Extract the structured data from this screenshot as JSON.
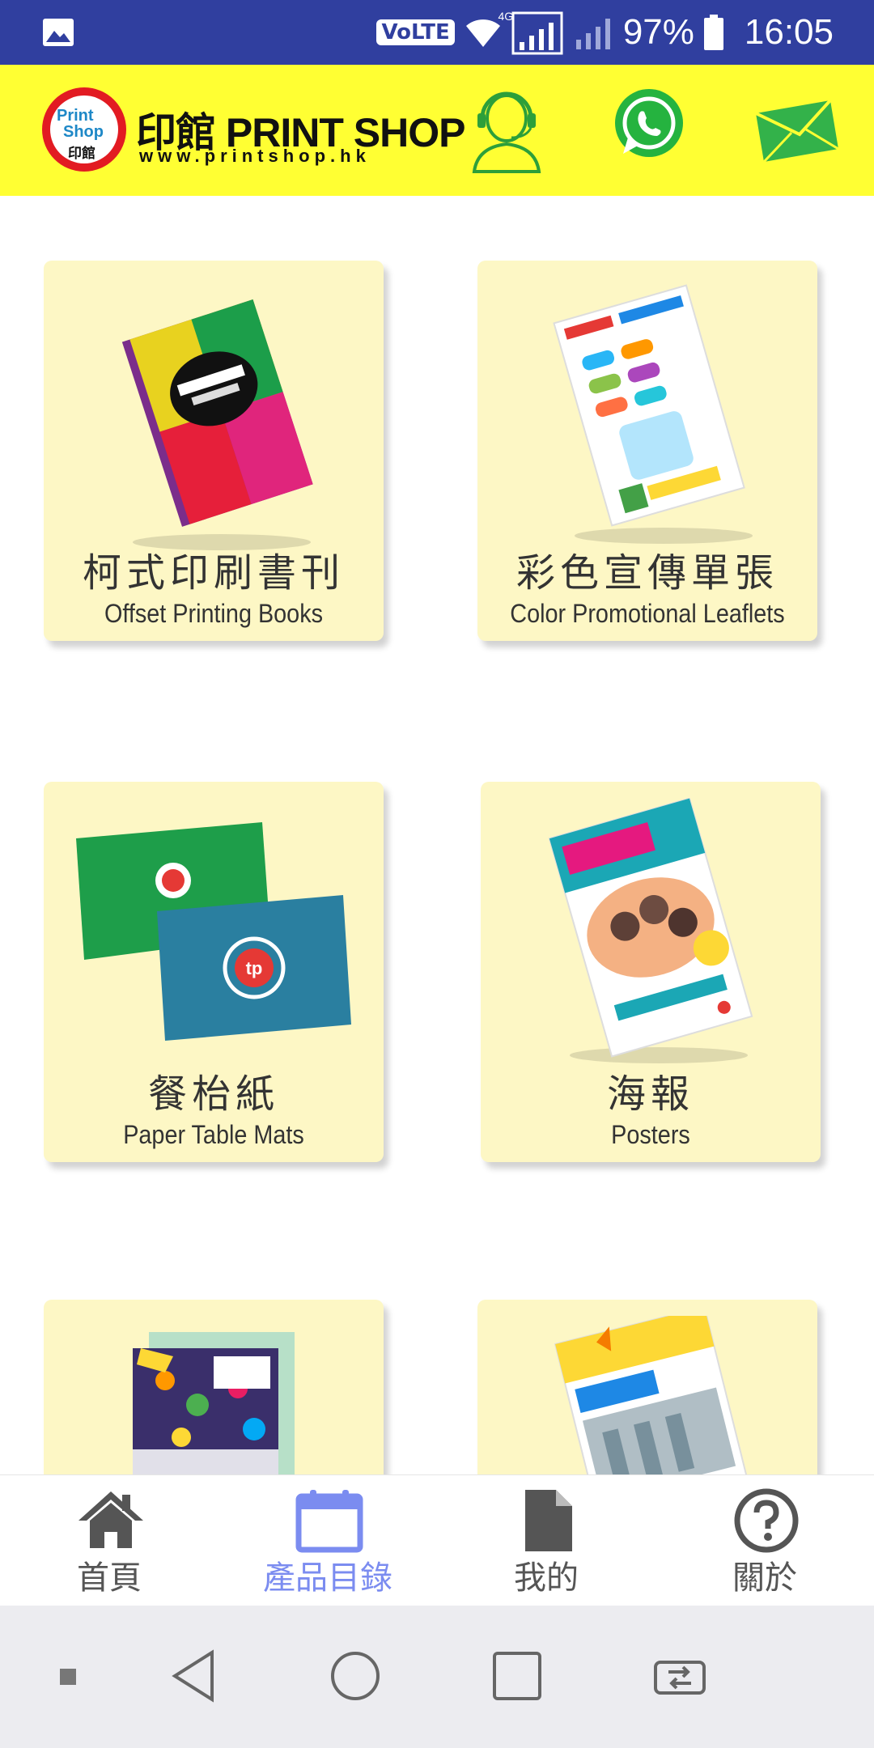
{
  "status_bar": {
    "volte_label": "VoLTE",
    "network_label": "4G",
    "battery_text": "97%",
    "time": "16:05",
    "icons": [
      "gallery-icon",
      "wifi-icon",
      "signal-icon",
      "battery-icon"
    ]
  },
  "header": {
    "logo_line1": "Print",
    "logo_line2": "Shop",
    "logo_line3": "印館",
    "brand_name": "印館 PRINT SHOP",
    "brand_url": "www.printshop.hk",
    "icons": [
      "customer-service-icon",
      "whatsapp-icon",
      "mail-icon"
    ],
    "colors": {
      "background": "#ffff33",
      "whatsapp": "#25b33f",
      "mail": "#33b24a"
    }
  },
  "products": [
    {
      "zh": "柯式印刷書刊",
      "en": "Offset Printing Books"
    },
    {
      "zh": "彩色宣傳單張",
      "en": "Color Promotional Leaflets"
    },
    {
      "zh": "餐枱紙",
      "en": "Paper Table Mats"
    },
    {
      "zh": "海報",
      "en": "Posters"
    },
    {
      "zh": "",
      "en": ""
    },
    {
      "zh": "",
      "en": ""
    }
  ],
  "bottom_nav": [
    {
      "label": "首頁",
      "icon": "home-icon",
      "active": false
    },
    {
      "label": "產品目錄",
      "icon": "calendar-icon",
      "active": true
    },
    {
      "label": "我的",
      "icon": "document-icon",
      "active": false
    },
    {
      "label": "關於",
      "icon": "help-icon",
      "active": false
    }
  ],
  "system_nav": [
    "square-dot-icon",
    "back-icon",
    "home-circle-icon",
    "recents-icon",
    "switch-icon"
  ],
  "colors": {
    "status_bar": "#303f9f",
    "card": "#fdf7c5",
    "nav_active": "#7b8cf0",
    "nav_inactive": "#555555"
  }
}
